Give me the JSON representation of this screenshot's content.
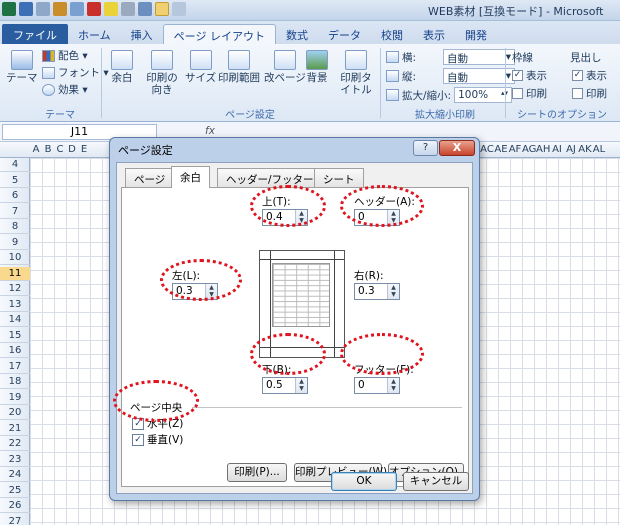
{
  "window": {
    "title": "WEB素材 [互換モード] - Microsoft"
  },
  "ribbon_tabs": [
    "ファイル",
    "ホーム",
    "挿入",
    "ページ レイアウト",
    "数式",
    "データ",
    "校閲",
    "表示",
    "開発"
  ],
  "ribbon": {
    "theme_group": {
      "label": "テーマ",
      "theme_btn": "テーマ",
      "colors": "配色 ▾",
      "fonts": "フォント ▾",
      "effects": "効果 ▾"
    },
    "page_setup_group": {
      "label": "ページ設定",
      "margins": "余白",
      "orientation": "印刷の向き",
      "size": "サイズ",
      "print_area": "印刷範囲",
      "breaks": "改ページ",
      "background": "背景",
      "print_titles": "印刷タイトル"
    },
    "scale_group": {
      "label": "拡大縮小印刷",
      "width_label": "横:",
      "width_value": "自動",
      "height_label": "縦:",
      "height_value": "自動",
      "scale_label": "拡大/縮小:",
      "scale_value": "100%"
    },
    "sheet_options_group": {
      "label": "シートのオプション",
      "gridlines": "枠線",
      "headings": "見出し",
      "view": "表示",
      "print": "印刷"
    }
  },
  "formula_bar": {
    "name_box": "J11",
    "fx": "fx"
  },
  "sheet": {
    "columns": [
      "A",
      "B",
      "C",
      "D",
      "E",
      "AC",
      "AE",
      "AF",
      "AG",
      "AH",
      "AI",
      "AJ",
      "AK",
      "AL"
    ],
    "rows": [
      "4",
      "5",
      "6",
      "7",
      "8",
      "9",
      "10",
      "11",
      "12",
      "13",
      "14",
      "15",
      "16",
      "17",
      "18",
      "19",
      "20",
      "21",
      "22",
      "23",
      "24",
      "25",
      "26",
      "27"
    ],
    "selected_row": "11"
  },
  "dialog": {
    "title": "ページ設定",
    "help": "?",
    "close": "X",
    "tabs": [
      "ページ",
      "余白",
      "ヘッダー/フッター",
      "シート"
    ],
    "active_tab": "余白",
    "fields": {
      "top": {
        "label": "上(T):",
        "value": "0.4"
      },
      "header": {
        "label": "ヘッダー(A):",
        "value": "0"
      },
      "left": {
        "label": "左(L):",
        "value": "0.3"
      },
      "right": {
        "label": "右(R):",
        "value": "0.3"
      },
      "bottom": {
        "label": "下(B):",
        "value": "0.5"
      },
      "footer": {
        "label": "フッター(F):",
        "value": "0"
      }
    },
    "centering": {
      "title": "ページ中央",
      "horizontal": "水平(Z)",
      "vertical": "垂直(V)"
    },
    "buttons": {
      "print": "印刷(P)...",
      "preview": "印刷プレビュー(W)",
      "options": "オプション(O)...",
      "ok": "OK",
      "cancel": "キャンセル"
    }
  },
  "colors": {
    "ribbon_bg": "#dde8f5",
    "file_tab": "#2a5d9f",
    "highlight_circle": "#e0141e",
    "selected_row": "#f9d98d"
  }
}
